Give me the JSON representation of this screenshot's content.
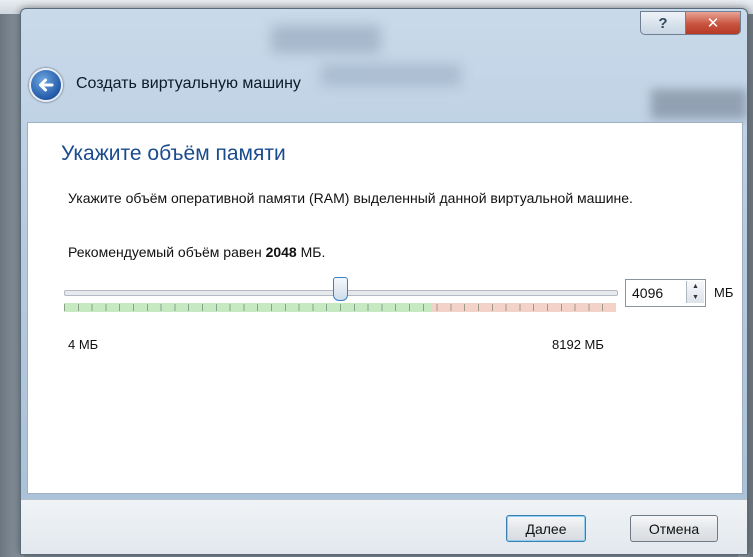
{
  "window": {
    "header_title": "Создать виртуальную машину",
    "help_label": "?",
    "close_label": "✕"
  },
  "page": {
    "title": "Укажите объём памяти",
    "description": "Укажите объём оперативной памяти (RAM) выделенный данной виртуальной машине.",
    "recommend_prefix": "Рекомендуемый объём равен",
    "recommend_value": "2048",
    "recommend_unit": "МБ."
  },
  "memory": {
    "min_label": "4 МБ",
    "max_label": "8192 МБ",
    "value": "4096",
    "unit": "МБ",
    "slider_min": 4,
    "slider_max": 8192,
    "slider_value": 4096,
    "recommended_zone_max": 5461
  },
  "buttons": {
    "next": "Далее",
    "cancel": "Отмена"
  },
  "icons": {
    "back": "back-arrow-icon",
    "spin_up": "triangle-up-icon",
    "spin_down": "triangle-down-icon"
  }
}
